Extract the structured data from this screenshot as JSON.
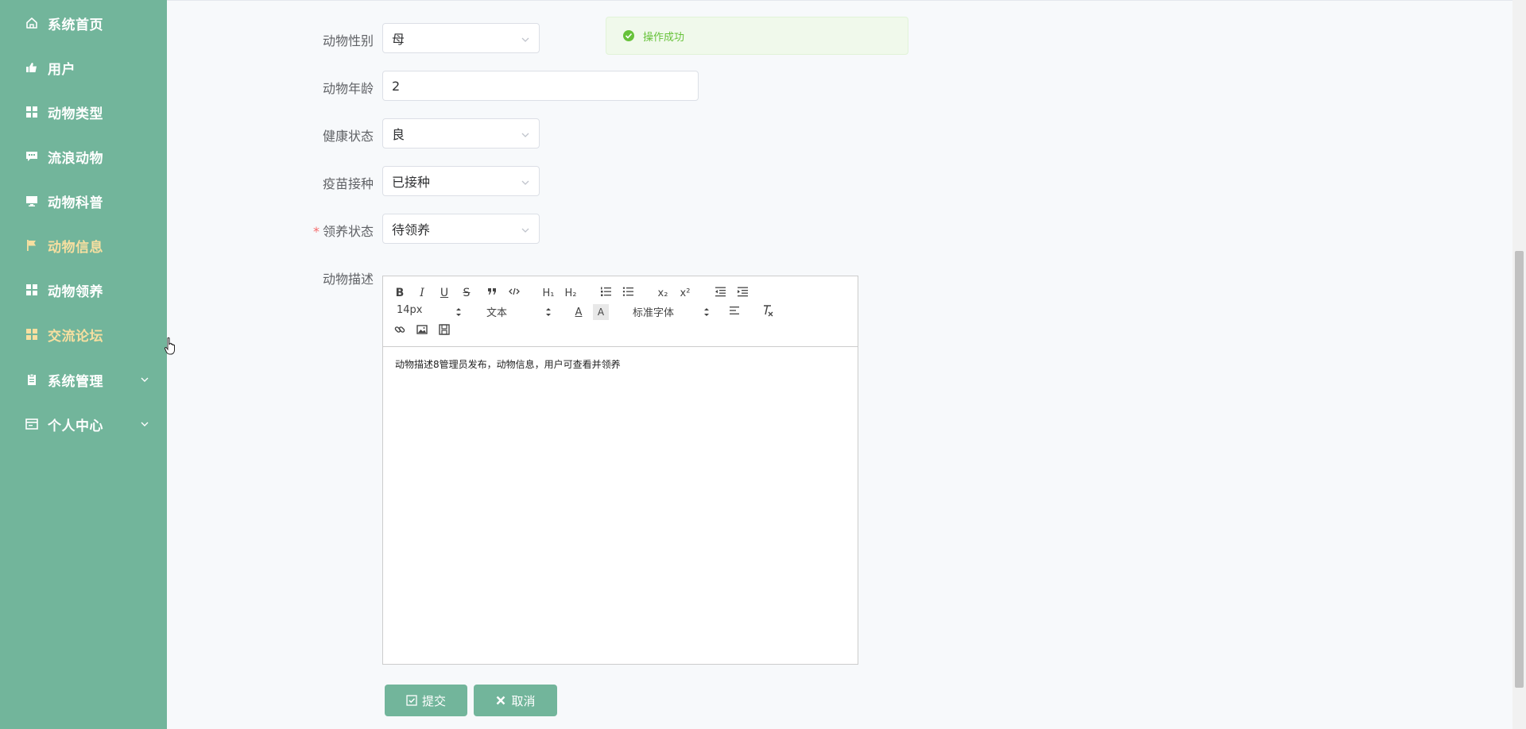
{
  "sidebar": {
    "items": [
      {
        "label": "系统首页",
        "icon": "home-icon",
        "active": false
      },
      {
        "label": "用户",
        "icon": "thumb-up-icon",
        "active": false
      },
      {
        "label": "动物类型",
        "icon": "grid-icon",
        "active": false
      },
      {
        "label": "流浪动物",
        "icon": "comment-icon",
        "active": false
      },
      {
        "label": "动物科普",
        "icon": "monitor-icon",
        "active": false
      },
      {
        "label": "动物信息",
        "icon": "flag-icon",
        "active": true
      },
      {
        "label": "动物领养",
        "icon": "grid-icon",
        "active": false
      },
      {
        "label": "交流论坛",
        "icon": "grid-icon",
        "active": true
      },
      {
        "label": "系统管理",
        "icon": "clipboard-icon",
        "active": false,
        "expandable": true
      },
      {
        "label": "个人中心",
        "icon": "card-icon",
        "active": false,
        "expandable": true
      }
    ],
    "active_color": "#f7dfa0"
  },
  "toast": {
    "text": "操作成功",
    "icon": "success-circle-icon"
  },
  "form": {
    "gender": {
      "label": "动物性别",
      "value": "母"
    },
    "age": {
      "label": "动物年龄",
      "value": "2"
    },
    "health": {
      "label": "健康状态",
      "value": "良"
    },
    "vaccine": {
      "label": "疫苗接种",
      "value": "已接种"
    },
    "adopt": {
      "label": "领养状态",
      "value": "待领养",
      "required_mark": "*"
    },
    "desc": {
      "label": "动物描述"
    }
  },
  "editor": {
    "toolbar": {
      "bold": "B",
      "italic": "I",
      "underline": "U",
      "strike": "S",
      "h1": "H₁",
      "h2": "H₂",
      "sub": "x₂",
      "sup": "x²",
      "size": "14px",
      "header": "文本",
      "font": "标准字体",
      "color": "A",
      "bg": "A"
    },
    "content": "动物描述8管理员发布，动物信息，用户可查看并领养"
  },
  "buttons": {
    "submit": "提交",
    "cancel": "取消"
  },
  "colors": {
    "sidebar": "#72b59b",
    "success": "#67c23a",
    "danger": "#f56c6c"
  }
}
